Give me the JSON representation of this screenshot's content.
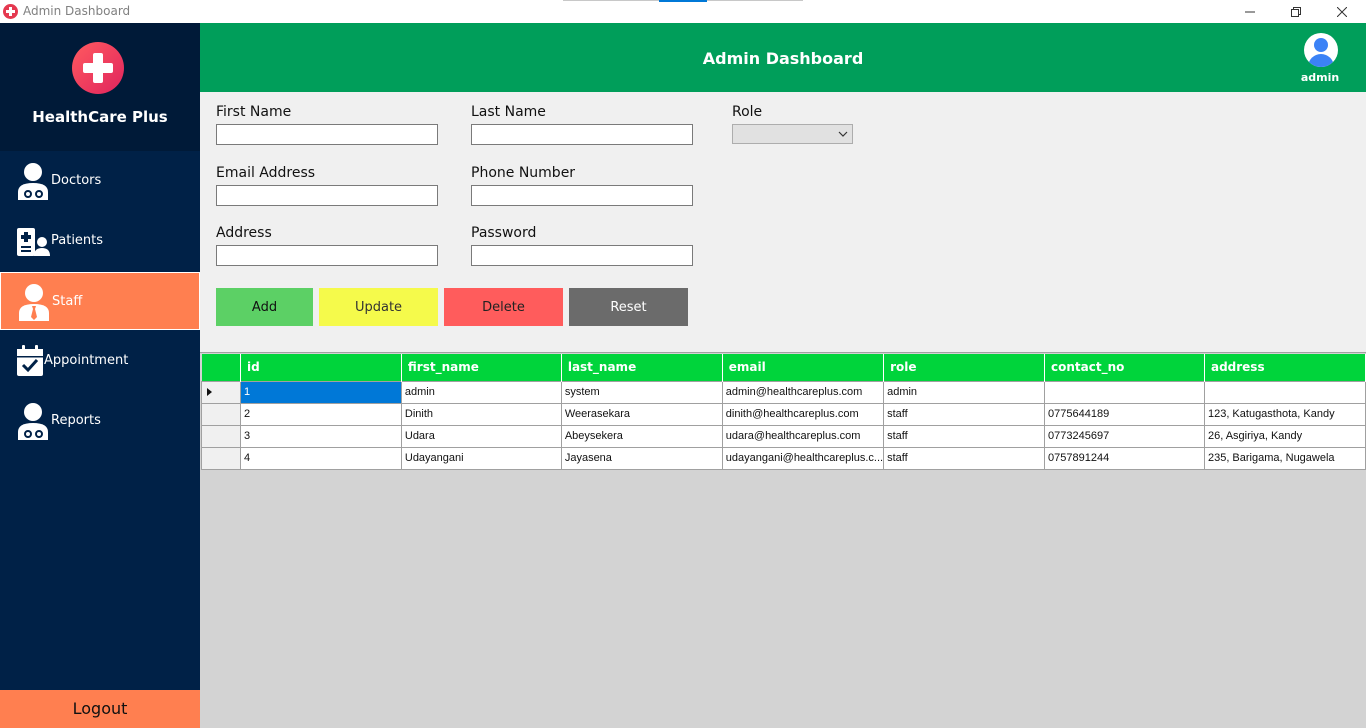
{
  "window": {
    "title": "Admin Dashboard",
    "controls": [
      "minimize",
      "restore",
      "close"
    ]
  },
  "sidebar": {
    "brand": "HealthCare Plus",
    "items": [
      {
        "label": "Doctors",
        "icon": "doctor-icon"
      },
      {
        "label": "Patients",
        "icon": "patients-icon"
      },
      {
        "label": "Staff",
        "icon": "staff-icon",
        "active": true
      },
      {
        "label": "Appointment",
        "icon": "calendar-icon"
      },
      {
        "label": "Reports",
        "icon": "reports-icon"
      }
    ],
    "logout": "Logout"
  },
  "header": {
    "title": "Admin Dashboard",
    "user": "admin"
  },
  "form": {
    "first_name_label": "First Name",
    "last_name_label": "Last Name",
    "role_label": "Role",
    "email_label": "Email Address",
    "phone_label": "Phone Number",
    "address_label": "Address",
    "password_label": "Password",
    "role_value": ""
  },
  "buttons": {
    "add": "Add",
    "update": "Update",
    "delete": "Delete",
    "reset": "Reset"
  },
  "colors": {
    "sidebar": "#002147",
    "header": "#009e5a",
    "accent": "#ff7f50",
    "grid_header": "#00d43b",
    "add": "#5cd065",
    "update": "#f5fa4b",
    "delete": "#ff5c5c",
    "reset": "#6b6b6b"
  },
  "grid": {
    "columns": [
      "id",
      "first_name",
      "last_name",
      "email",
      "role",
      "contact_no",
      "address"
    ],
    "rows": [
      [
        "1",
        "admin",
        "system",
        "admin@healthcareplus.com",
        "admin",
        "",
        ""
      ],
      [
        "2",
        "Dinith",
        "Weerasekara",
        "dinith@healthcareplus.com",
        "staff",
        "0775644189",
        "123, Katugasthota, Kandy"
      ],
      [
        "3",
        "Udara",
        "Abeysekera",
        "udara@healthcareplus.com",
        "staff",
        "0773245697",
        "26, Asgiriya, Kandy"
      ],
      [
        "4",
        "Udayangani",
        "Jayasena",
        "udayangani@healthcareplus.c...",
        "staff",
        "0757891244",
        "235, Barigama, Nugawela"
      ]
    ]
  }
}
